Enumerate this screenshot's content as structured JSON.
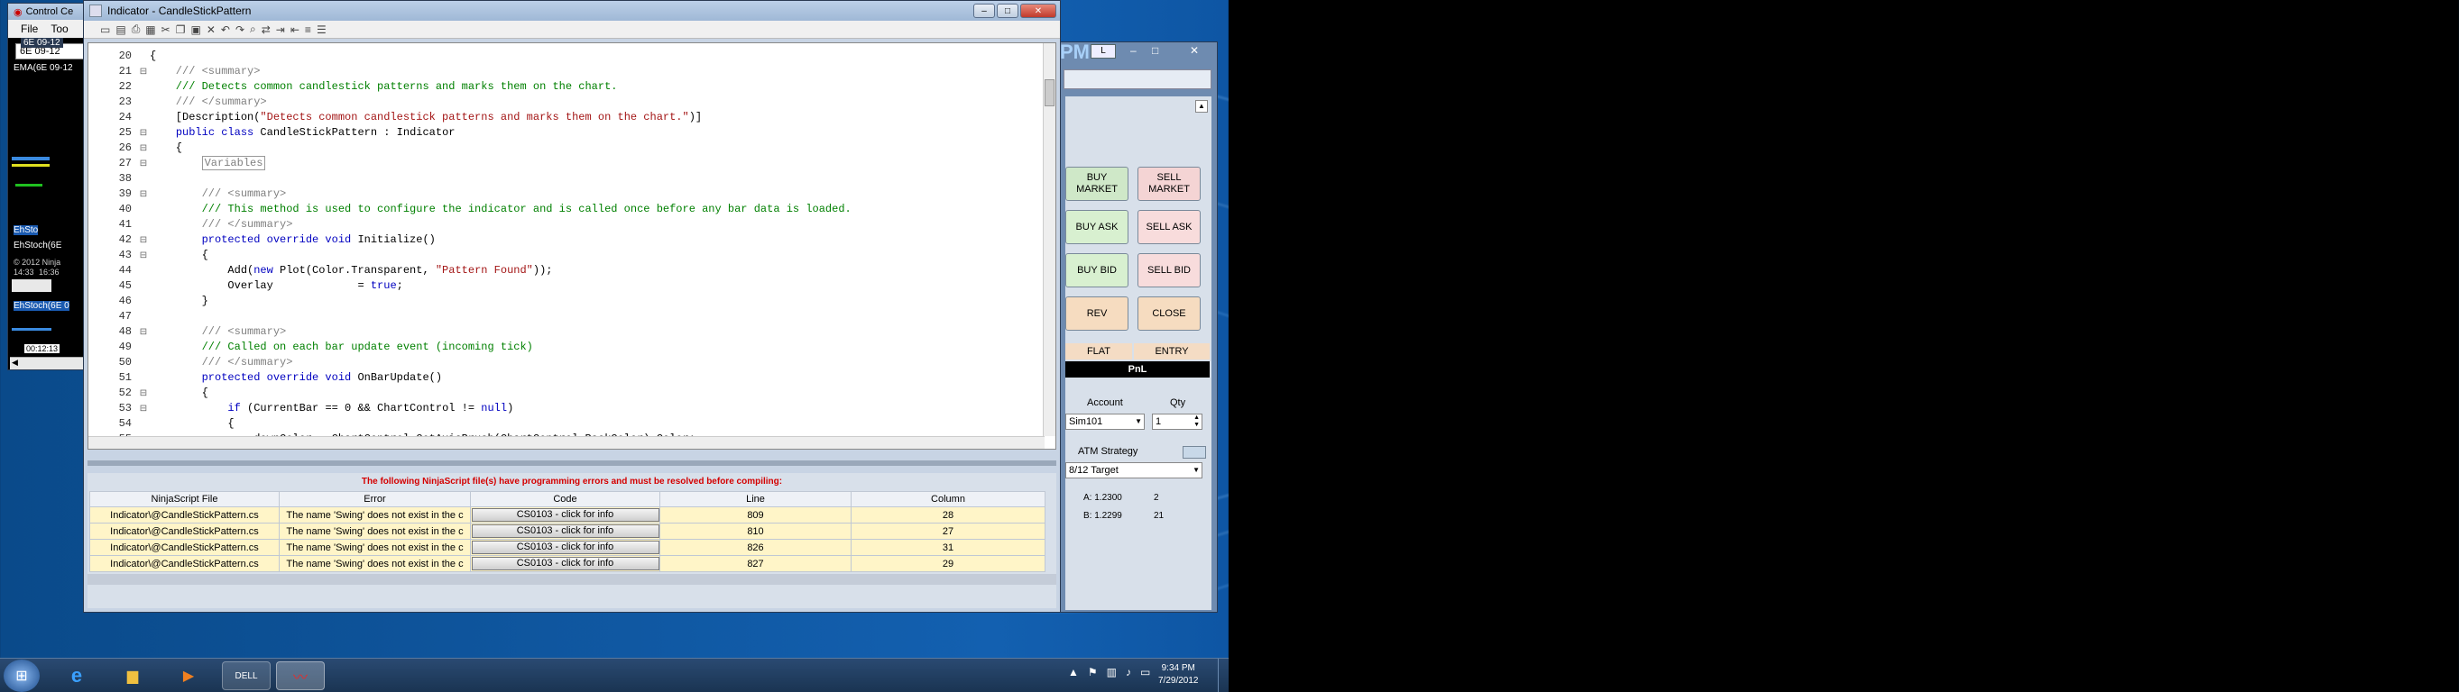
{
  "editor": {
    "title": "Indicator - CandleStickPattern",
    "lines": [
      {
        "n": "20",
        "parts": [
          {
            "t": "{",
            "c": ""
          }
        ]
      },
      {
        "n": "21",
        "parts": [
          {
            "t": "    /// <summary>",
            "c": "gr"
          }
        ]
      },
      {
        "n": "22",
        "parts": [
          {
            "t": "    /// Detects common candlestick patterns and marks them on the chart.",
            "c": "cm"
          }
        ]
      },
      {
        "n": "23",
        "parts": [
          {
            "t": "    /// </summary>",
            "c": "gr"
          }
        ]
      },
      {
        "n": "24",
        "parts": [
          {
            "t": "    [Description(",
            "c": ""
          },
          {
            "t": "\"Detects common candlestick patterns and marks them on the chart.\"",
            "c": "st"
          },
          {
            "t": ")]",
            "c": ""
          }
        ]
      },
      {
        "n": "25",
        "parts": [
          {
            "t": "    ",
            "c": ""
          },
          {
            "t": "public class",
            "c": "kw"
          },
          {
            "t": " CandleStickPattern : Indicator",
            "c": ""
          }
        ]
      },
      {
        "n": "26",
        "parts": [
          {
            "t": "    {",
            "c": ""
          }
        ]
      },
      {
        "n": "27",
        "parts": [
          {
            "t": "        ",
            "c": ""
          },
          {
            "t": "Variables",
            "c": "gr"
          }
        ]
      },
      {
        "n": "38",
        "parts": [
          {
            "t": "",
            "c": ""
          }
        ]
      },
      {
        "n": "39",
        "parts": [
          {
            "t": "        /// <summary>",
            "c": "gr"
          }
        ]
      },
      {
        "n": "40",
        "parts": [
          {
            "t": "        /// This method is used to configure the indicator and is called once before any bar data is loaded.",
            "c": "cm"
          }
        ]
      },
      {
        "n": "41",
        "parts": [
          {
            "t": "        /// </summary>",
            "c": "gr"
          }
        ]
      },
      {
        "n": "42",
        "parts": [
          {
            "t": "        ",
            "c": ""
          },
          {
            "t": "protected override void",
            "c": "kw"
          },
          {
            "t": " Initialize()",
            "c": ""
          }
        ]
      },
      {
        "n": "43",
        "parts": [
          {
            "t": "        {",
            "c": ""
          }
        ]
      },
      {
        "n": "44",
        "parts": [
          {
            "t": "            Add(",
            "c": ""
          },
          {
            "t": "new",
            "c": "kw"
          },
          {
            "t": " Plot(Color.Transparent, ",
            "c": ""
          },
          {
            "t": "\"Pattern Found\"",
            "c": "st"
          },
          {
            "t": "));",
            "c": ""
          }
        ]
      },
      {
        "n": "45",
        "parts": [
          {
            "t": "            Overlay             = ",
            "c": ""
          },
          {
            "t": "true",
            "c": "kw"
          },
          {
            "t": ";",
            "c": ""
          }
        ]
      },
      {
        "n": "46",
        "parts": [
          {
            "t": "        }",
            "c": ""
          }
        ]
      },
      {
        "n": "47",
        "parts": [
          {
            "t": "",
            "c": ""
          }
        ]
      },
      {
        "n": "48",
        "parts": [
          {
            "t": "        /// <summary>",
            "c": "gr"
          }
        ]
      },
      {
        "n": "49",
        "parts": [
          {
            "t": "        /// Called on each bar update event (incoming tick)",
            "c": "cm"
          }
        ]
      },
      {
        "n": "50",
        "parts": [
          {
            "t": "        /// </summary>",
            "c": "gr"
          }
        ]
      },
      {
        "n": "51",
        "parts": [
          {
            "t": "        ",
            "c": ""
          },
          {
            "t": "protected override void",
            "c": "kw"
          },
          {
            "t": " OnBarUpdate()",
            "c": ""
          }
        ]
      },
      {
        "n": "52",
        "parts": [
          {
            "t": "        {",
            "c": ""
          }
        ]
      },
      {
        "n": "53",
        "parts": [
          {
            "t": "            ",
            "c": ""
          },
          {
            "t": "if",
            "c": "kw"
          },
          {
            "t": " (CurrentBar == 0 && ChartControl != ",
            "c": ""
          },
          {
            "t": "null",
            "c": "kw"
          },
          {
            "t": ")",
            "c": ""
          }
        ]
      },
      {
        "n": "54",
        "parts": [
          {
            "t": "            {",
            "c": ""
          }
        ]
      },
      {
        "n": "55",
        "parts": [
          {
            "t": "                downColor = ChartControl.GetAxisBrush(ChartControl.BackColor).Color;",
            "c": ""
          }
        ]
      }
    ],
    "error_banner": "The following NinjaScript file(s) have programming errors and must be resolved before compiling:",
    "error_columns": [
      "NinjaScript File",
      "Error",
      "Code",
      "Line",
      "Column"
    ],
    "errors": [
      {
        "file": "Indicator\\@CandleStickPattern.cs",
        "error": "The name 'Swing' does not exist in the c",
        "code": "CS0103 - click for info",
        "line": "809",
        "column": "28"
      },
      {
        "file": "Indicator\\@CandleStickPattern.cs",
        "error": "The name 'Swing' does not exist in the c",
        "code": "CS0103 - click for info",
        "line": "810",
        "column": "27"
      },
      {
        "file": "Indicator\\@CandleStickPattern.cs",
        "error": "The name 'Swing' does not exist in the c",
        "code": "CS0103 - click for info",
        "line": "826",
        "column": "31"
      },
      {
        "file": "Indicator\\@CandleStickPattern.cs",
        "error": "The name 'Swing' does not exist in the c",
        "code": "CS0103 - click for info",
        "line": "827",
        "column": "29"
      }
    ]
  },
  "control_center": {
    "title": "Control Ce",
    "menu_file": "File",
    "menu_tools": "Too",
    "instrument": "6E 09-12",
    "chart_label1": "6E 09-12",
    "chart_label2": "EMA(6E 09-12",
    "stoch1": "EhSto",
    "stoch2": "EhStoch(6E",
    "copyright": "© 2012 Ninja",
    "time1": "14:33",
    "time2": "16:36",
    "stoch3": "EhStoch(6E 0",
    "time3": "00:12:13"
  },
  "superdom": {
    "pm_text": "PM",
    "l_button": "L",
    "buttons": [
      {
        "label": "BUY MARKET",
        "bg": "#cfe8c8"
      },
      {
        "label": "SELL MARKET",
        "bg": "#f4d4d4"
      },
      {
        "label": "BUY ASK",
        "bg": "#d8f0d0"
      },
      {
        "label": "SELL ASK",
        "bg": "#f8dcdc"
      },
      {
        "label": "BUY BID",
        "bg": "#d8f0d0"
      },
      {
        "label": "SELL BID",
        "bg": "#f8dcdc"
      },
      {
        "label": "REV",
        "bg": "#f6dcc0"
      },
      {
        "label": "CLOSE",
        "bg": "#f6dcc0"
      }
    ],
    "flat": "FLAT",
    "entry": "ENTRY",
    "pnl": "PnL",
    "account_label": "Account",
    "qty_label": "Qty",
    "account_value": "Sim101",
    "qty_value": "1",
    "atm_label": "ATM Strategy",
    "atm_value": "8/12 Target",
    "a_label": "A: 1.2300",
    "a_qty": "2",
    "b_label": "B: 1.2299",
    "b_qty": "21"
  },
  "taskbar": {
    "time": "9:34 PM",
    "date": "7/29/2012"
  },
  "colors": {
    "error_red": "#d40000",
    "row_yellow": "#fff5c8",
    "pnl_bg": "#000000"
  }
}
